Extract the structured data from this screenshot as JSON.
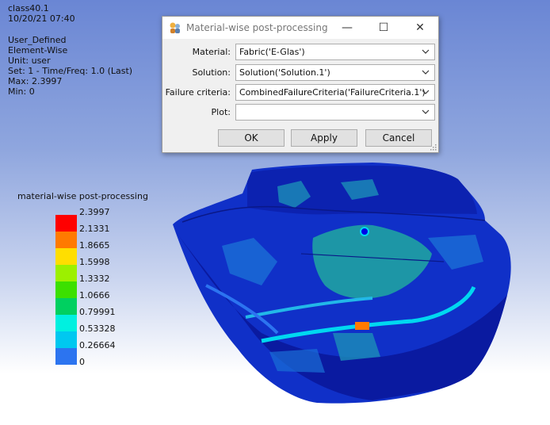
{
  "viewport": {
    "info_lines": [
      "class40.1",
      "10/20/21 07:40",
      "",
      "User_Defined",
      "Element-Wise",
      "Unit: user",
      "Set: 1 - Time/Freq: 1.0 (Last)",
      "Max: 2.3997",
      "Min: 0"
    ]
  },
  "legend": {
    "title": "material-wise post-processing",
    "labels": [
      "2.3997",
      "2.1331",
      "1.8665",
      "1.5998",
      "1.3332",
      "1.0666",
      "0.79991",
      "0.53328",
      "0.26664",
      "0"
    ],
    "colors": [
      "#ff0000",
      "#ff7a00",
      "#ffde00",
      "#9cf000",
      "#3ce000",
      "#00d060",
      "#00f0e0",
      "#00c8f0",
      "#2c74f0",
      "#0000e8"
    ]
  },
  "dialog": {
    "title": "Material-wise post-processing",
    "minimize": "—",
    "maximize": "☐",
    "close": "✕",
    "fields": [
      {
        "label": "Material:",
        "value": "Fabric('E-Glas')"
      },
      {
        "label": "Solution:",
        "value": "Solution('Solution.1')"
      },
      {
        "label": "Failure criteria:",
        "value": "CombinedFailureCriteria('FailureCriteria.1')"
      },
      {
        "label": "Plot:",
        "value": ""
      }
    ],
    "buttons": {
      "ok": "OK",
      "apply": "Apply",
      "cancel": "Cancel"
    }
  },
  "colors": {
    "model_base": "#1030c8",
    "model_dark": "#0a1aa0",
    "model_green": "#20a8a0",
    "model_cyan": "#00d8f0"
  }
}
